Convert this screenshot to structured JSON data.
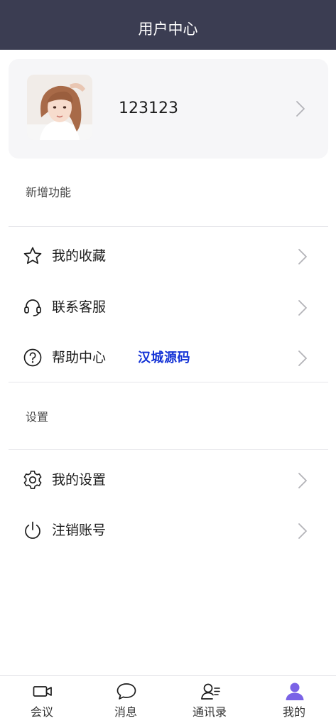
{
  "header": {
    "title": "用户中心"
  },
  "profile": {
    "username": "123123"
  },
  "sections": {
    "new_features": "新增功能",
    "settings": "设置"
  },
  "menu": {
    "favorites": "我的收藏",
    "support": "联系客服",
    "help": "帮助中心",
    "my_settings": "我的设置",
    "logout": "注销账号"
  },
  "watermark": "汉城源码",
  "tabs": [
    {
      "label": "会议",
      "icon": "video-camera-icon",
      "active": false
    },
    {
      "label": "消息",
      "icon": "chat-bubble-icon",
      "active": false
    },
    {
      "label": "通讯录",
      "icon": "contacts-icon",
      "active": false
    },
    {
      "label": "我的",
      "icon": "person-icon",
      "active": true
    }
  ],
  "colors": {
    "header_bg": "#3b3d52",
    "active_tab": "#7a63e6",
    "watermark": "#1433d6"
  }
}
